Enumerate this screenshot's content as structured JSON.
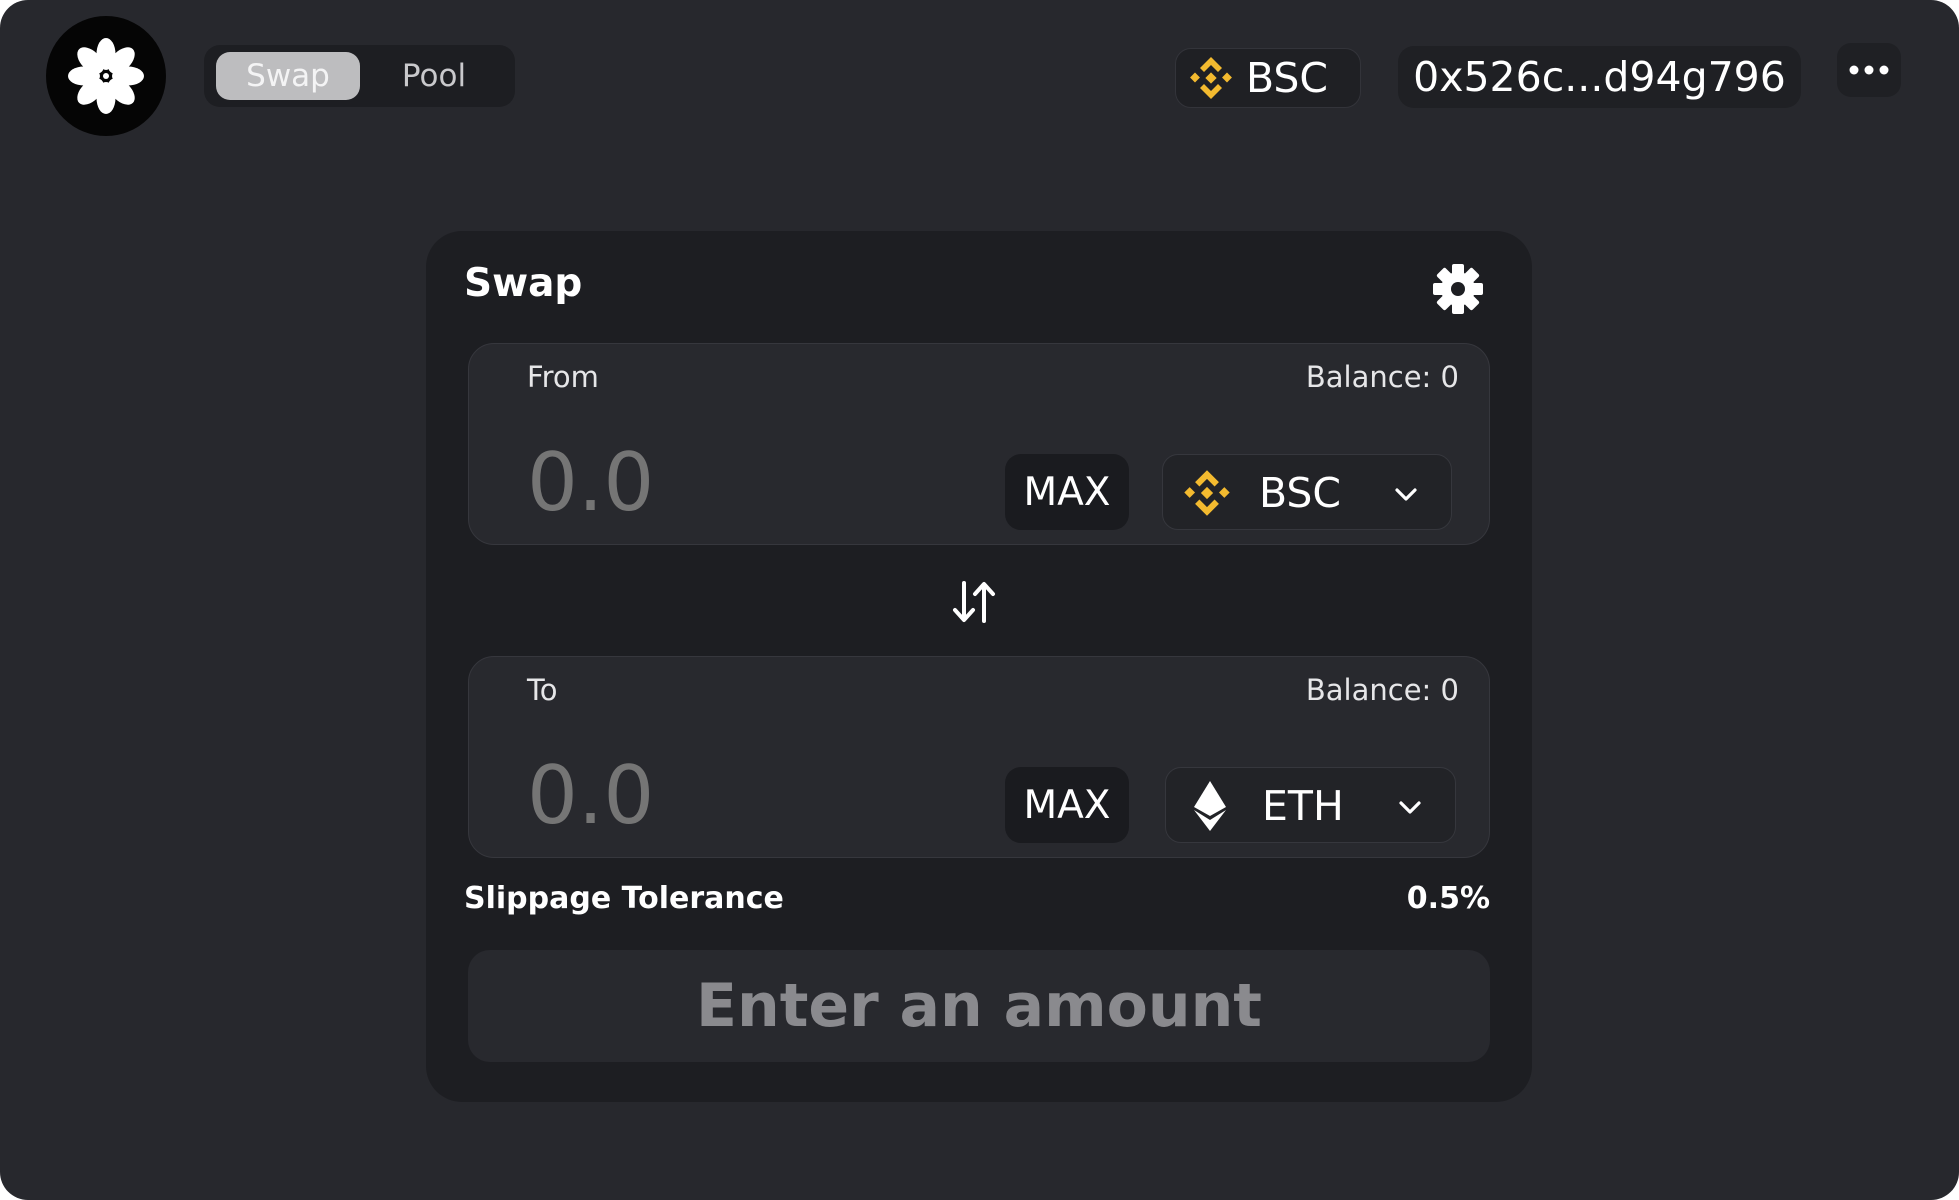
{
  "nav": {
    "tabs": [
      {
        "label": "Swap",
        "active": true
      },
      {
        "label": "Pool",
        "active": false
      }
    ]
  },
  "header": {
    "network_label": "BSC",
    "network_icon": "bnb-icon",
    "wallet_address": "0x526c...d94g796",
    "more_icon": "more-dots-icon"
  },
  "swap": {
    "title": "Swap",
    "settings_icon": "gear-icon",
    "from": {
      "label": "From",
      "balance": "Balance: 0",
      "amount_placeholder": "0.0",
      "max_label": "MAX",
      "token": "BSC",
      "token_icon": "bnb-icon"
    },
    "to": {
      "label": "To",
      "balance": "Balance: 0",
      "amount_placeholder": "0.0",
      "max_label": "MAX",
      "token": "ETH",
      "token_icon": "eth-icon"
    },
    "slippage_label": "Slippage Tolerance",
    "slippage_value": "0.5%",
    "submit_label": "Enter an amount"
  },
  "colors": {
    "app_background": "#27282d",
    "card_background": "#1d1e22",
    "bnb_yellow": "#f3ba2f",
    "disabled_text": "#8a8a8e"
  }
}
